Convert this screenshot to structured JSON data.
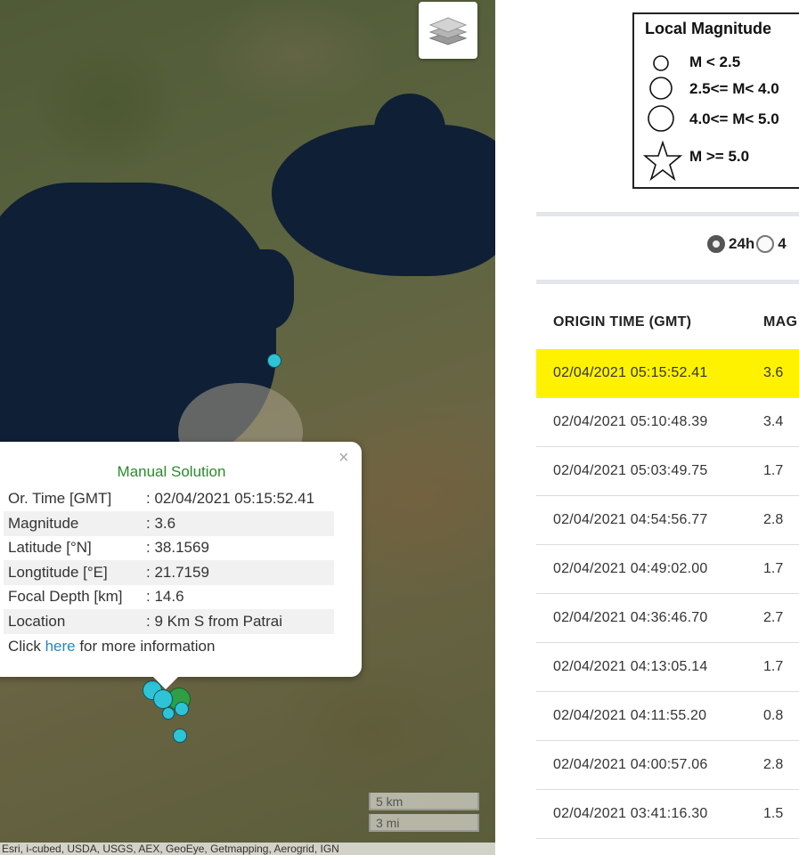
{
  "map": {
    "attribution": "Esri, i-cubed, USDA, USGS, AEX, GeoEye, Getmapping, Aerogrid, IGN",
    "scale": {
      "km": "5 km",
      "mi": "3 mi"
    },
    "popup": {
      "title": "Manual Solution",
      "rows": [
        {
          "label": "Or. Time [GMT]",
          "value": ": 02/04/2021 05:15:52.41"
        },
        {
          "label": "Magnitude",
          "value": ": 3.6"
        },
        {
          "label": "Latitude [°N]",
          "value": ": 38.1569"
        },
        {
          "label": "Longtitude [°E]",
          "value": ": 21.7159"
        },
        {
          "label": "Focal Depth [km]",
          "value": ": 14.6"
        },
        {
          "label": "Location",
          "value": ": 9 Km S from Patrai"
        }
      ],
      "more_prefix": "Click ",
      "more_link": "here",
      "more_suffix": " for more information",
      "close": "×"
    },
    "quake_colors": {
      "cyan": "#2ec4d6",
      "green": "#2f9e44"
    }
  },
  "legend": {
    "title": "Local Magnitude",
    "items": [
      {
        "label": "M < 2.5"
      },
      {
        "label": "2.5<= M< 4.0"
      },
      {
        "label": "4.0<= M< 5.0"
      },
      {
        "label": "M >= 5.0"
      }
    ]
  },
  "range": {
    "option1": "24h",
    "option2": "4",
    "selected": "24h"
  },
  "table": {
    "headers": {
      "time": "ORIGIN TIME (GMT)",
      "mag": "MAG"
    },
    "highlight_color": "#fff200",
    "rows": [
      {
        "time": "02/04/2021 05:15:52.41",
        "mag": "3.6"
      },
      {
        "time": "02/04/2021 05:10:48.39",
        "mag": "3.4"
      },
      {
        "time": "02/04/2021 05:03:49.75",
        "mag": "1.7"
      },
      {
        "time": "02/04/2021 04:54:56.77",
        "mag": "2.8"
      },
      {
        "time": "02/04/2021 04:49:02.00",
        "mag": "1.7"
      },
      {
        "time": "02/04/2021 04:36:46.70",
        "mag": "2.7"
      },
      {
        "time": "02/04/2021 04:13:05.14",
        "mag": "1.7"
      },
      {
        "time": "02/04/2021 04:11:55.20",
        "mag": "0.8"
      },
      {
        "time": "02/04/2021 04:00:57.06",
        "mag": "2.8"
      },
      {
        "time": "02/04/2021 03:41:16.30",
        "mag": "1.5"
      }
    ]
  }
}
